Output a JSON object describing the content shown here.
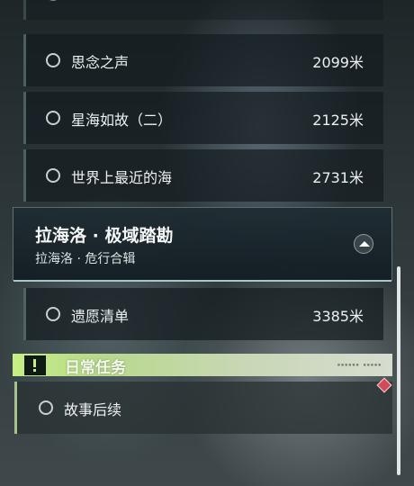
{
  "quests_above": [
    {
      "name": "思念之声",
      "distance": "2099米"
    },
    {
      "name": "星海如故（二）",
      "distance": "2125米"
    },
    {
      "name": "世界上最近的海",
      "distance": "2731米"
    }
  ],
  "section": {
    "title": "拉海洛 · 极域踏勘",
    "subtitle": "拉海洛 · 危行合辑",
    "quests": [
      {
        "name": "遗愿清单",
        "distance": "3385米"
      }
    ]
  },
  "daily": {
    "label": "日常任务",
    "quests": [
      {
        "name": "故事后续"
      }
    ]
  },
  "icons": {
    "quest_status": "circle-outline-icon",
    "collapse": "chevron-up-icon",
    "daily_header": "exclamation-icon",
    "new_badge": "diamond-icon"
  },
  "colors": {
    "daily_accent": "#c7ef84",
    "new_badge": "#d44a5a"
  },
  "scroll": {
    "thumb_fraction": 0.43
  }
}
